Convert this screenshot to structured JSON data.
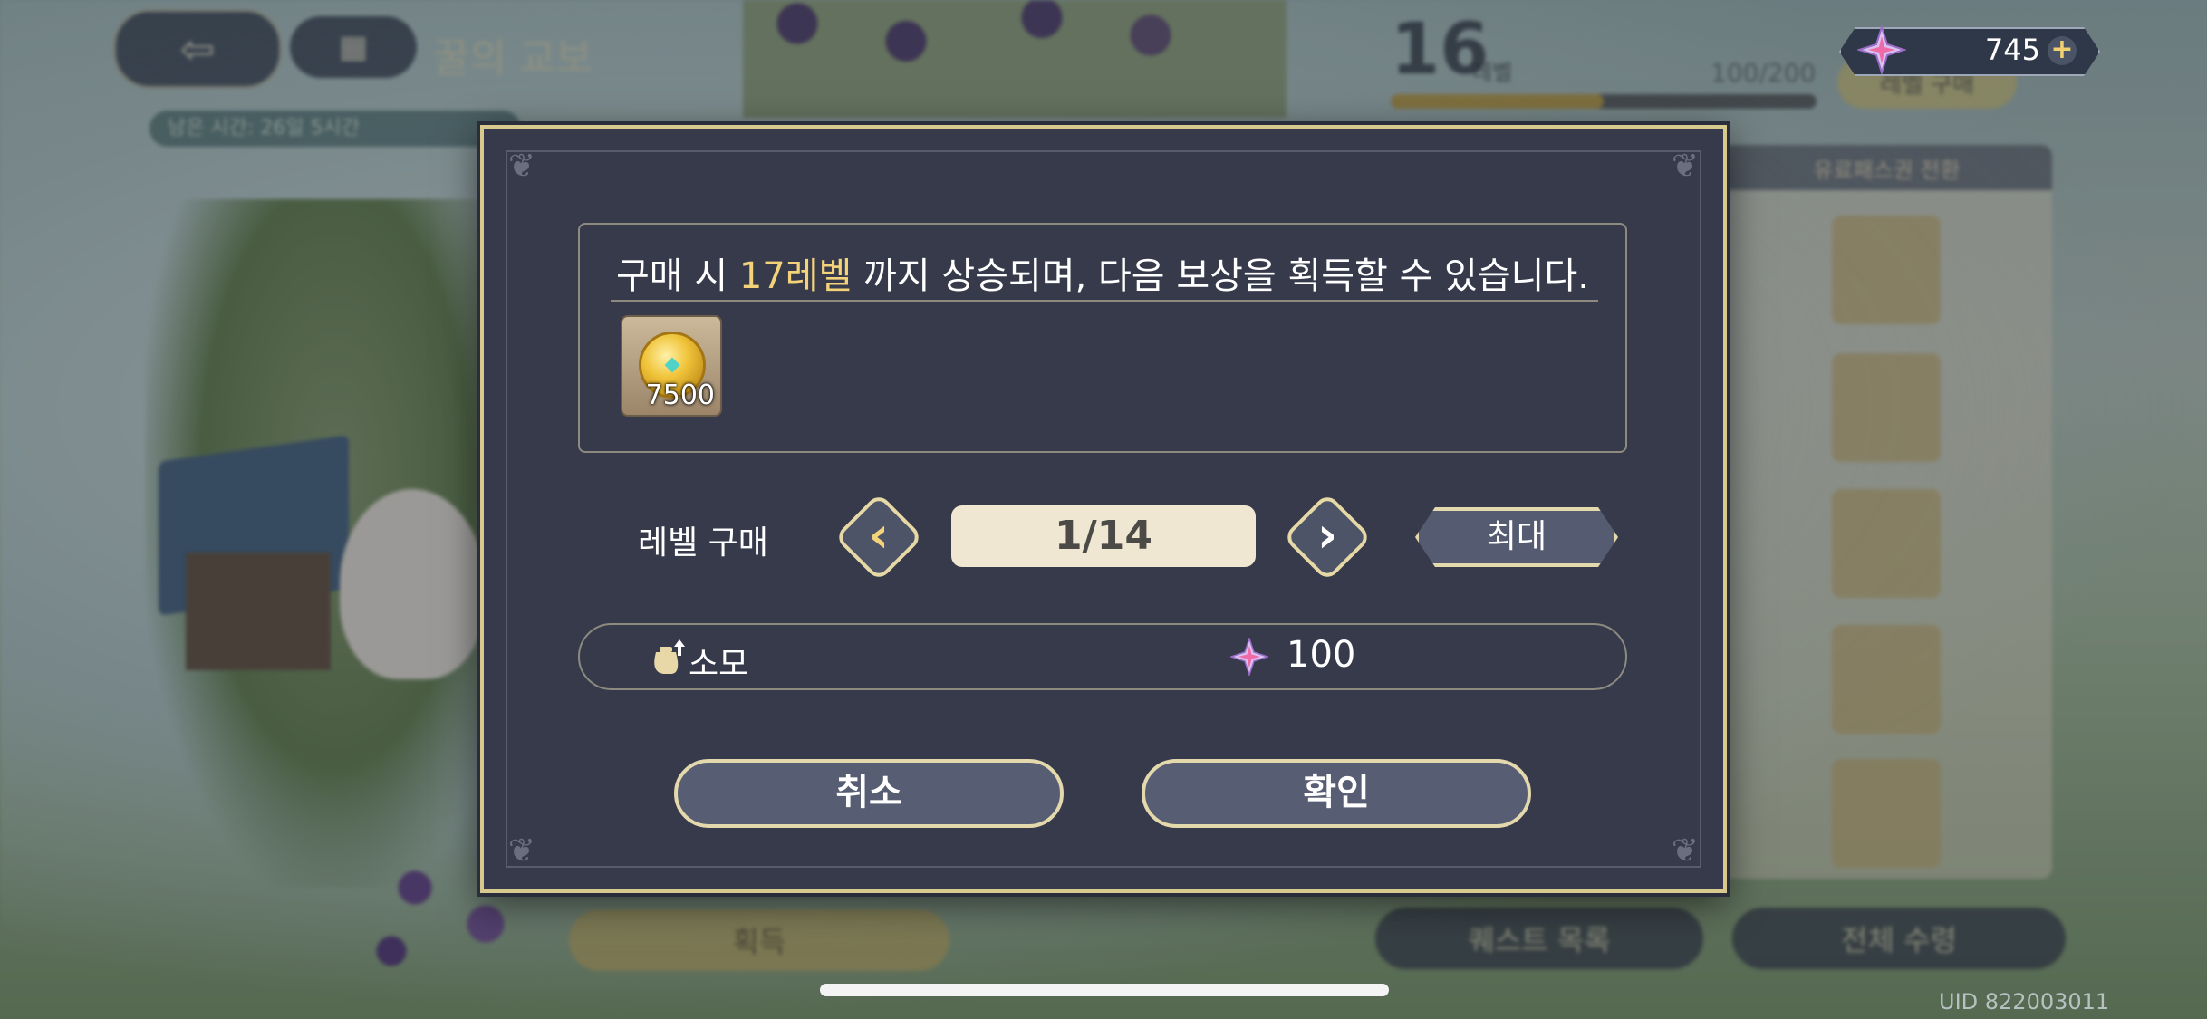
{
  "background": {
    "title": "꿀의 교보",
    "notice": "남은 시간: 26일 5시간",
    "level": "16",
    "level_unit": "레벨",
    "exp": "100/200",
    "buy_tag": "레벨 구매",
    "panel_header": "유료패스권 전환",
    "quest_button": "퀘스트 목록",
    "claim_all_button": "전체 수령",
    "get_button": "획득",
    "uid": "UID 822003011"
  },
  "currency": {
    "icon": "purple-star-gem-icon",
    "value": "745",
    "add_icon": "plus-icon"
  },
  "modal": {
    "reward_text_before": "구매 시 ",
    "reward_text_highlight": "17레벨",
    "reward_text_after": " 까지 상승되며, 다음 보상을 획득할 수 있습니다.",
    "reward_item": {
      "icon": "gold-coin-icon",
      "count": "7500"
    },
    "level_label": "레벨 구매",
    "quantity": "1/14",
    "max_label": "최대",
    "cost_label": "소모",
    "cost_icon": "money-bag-up-icon",
    "cost_currency_icon": "purple-star-gem-icon",
    "cost_value": "100",
    "cancel_label": "취소",
    "confirm_label": "확인"
  },
  "colors": {
    "modal_bg": "#363a4b",
    "border_gold": "#d8c98f",
    "highlight": "#f3d27a"
  }
}
